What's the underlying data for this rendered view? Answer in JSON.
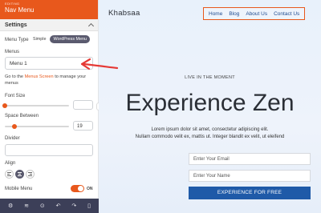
{
  "panel": {
    "subtitle": "EDITING",
    "title": "Nav Menu",
    "section_title": "Settings",
    "menu_type_label": "Menu Type",
    "menu_type_options": [
      "Simple",
      "WordPress Menu"
    ],
    "menus_label": "Menus",
    "menus_value": "Menu 1",
    "note_before": "Go to the ",
    "note_link": "Menus Screen",
    "note_after": " to manage your menus",
    "font_size_label": "Font Size",
    "font_size_value": "",
    "space_between_label": "Space Between",
    "space_between_value": "19",
    "divider_label": "Divider",
    "align_label": "Align",
    "mobile_menu_label": "Mobile Menu",
    "mobile_menu_state": "ON",
    "font_size_slider_level": 0.0,
    "space_between_slider_level": 0.15
  },
  "footer_icons": [
    "gear-icon",
    "layers-icon",
    "save-icon",
    "undo-icon",
    "redo-icon",
    "mobile-icon"
  ],
  "footer_glyphs": [
    "⚙",
    "≋",
    "⊙",
    "↶",
    "↷",
    "▯"
  ],
  "preview": {
    "brand": "Khabsaa",
    "nav_items": [
      "Home",
      "Blog",
      "About Us",
      "Contact Us"
    ],
    "tagline": "LIVE IN THE MOMENT",
    "headline": "Experience Zen",
    "lead_line1": "Lorem ipsum dolor sit amet, consectetur adipiscing elit.",
    "lead_line2": "Nullam commodo velit ex, mattis ut. Integer blandit ex velit, ut eleifend",
    "email_placeholder": "Enter Your Email",
    "name_placeholder": "Enter Your Name",
    "cta_label": "EXPERIENCE FOR FREE"
  },
  "colors": {
    "accent": "#e8581c",
    "footer_bg": "#3c3f58",
    "cta_bg": "#1f5aa8",
    "annotation_arrow": "#e53935"
  }
}
